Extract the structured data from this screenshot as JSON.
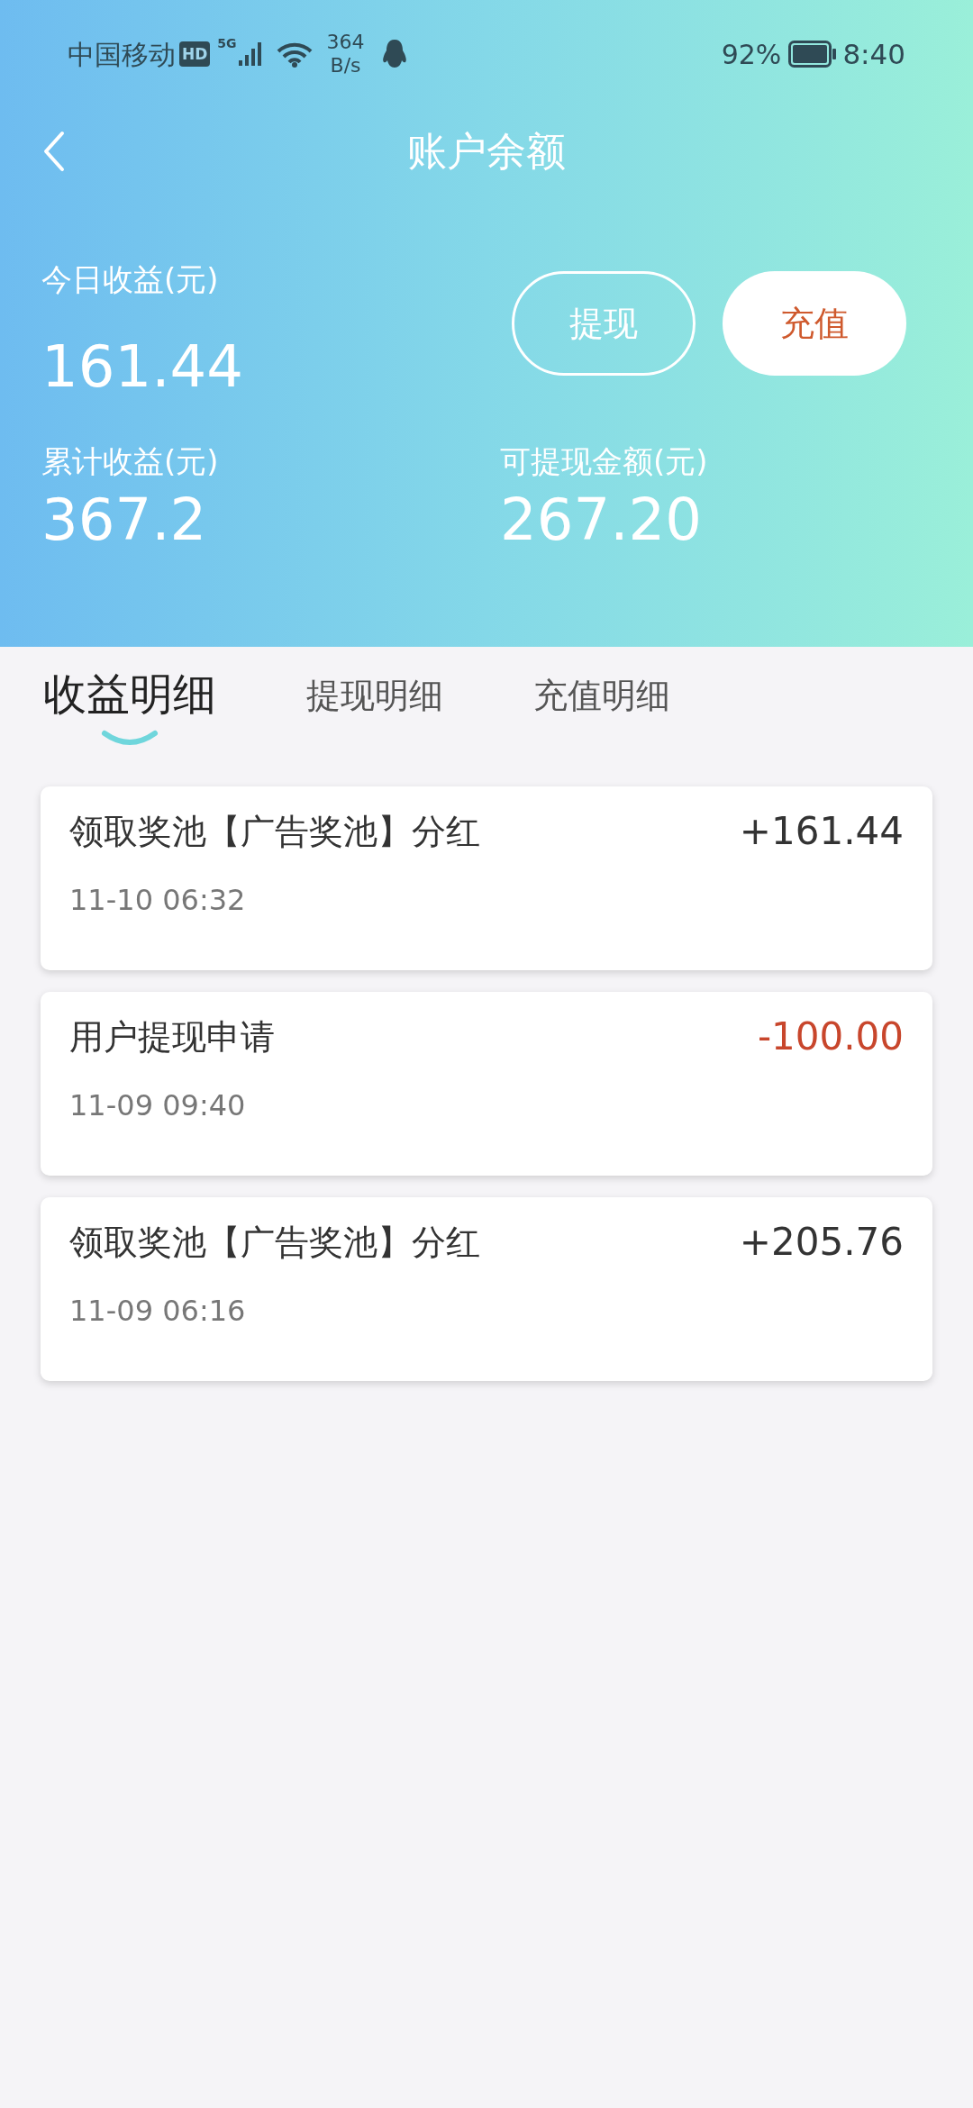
{
  "status_bar": {
    "carrier": "中国移动",
    "hd_badge": "HD",
    "network": "5G",
    "speed_value": "364",
    "speed_unit": "B/s",
    "battery": "92%",
    "time": "8:40"
  },
  "header": {
    "title": "账户余额"
  },
  "summary": {
    "today_label": "今日收益(元)",
    "today_value": "161.44",
    "total_label": "累计收益(元)",
    "total_value": "367.2",
    "withdrawable_label": "可提现金额(元)",
    "withdrawable_value": "267.20",
    "buttons": [
      {
        "label": "提现",
        "kind": "outline"
      },
      {
        "label": "充值",
        "kind": "filled"
      }
    ]
  },
  "tabs": [
    {
      "label": "收益明细",
      "selected": true
    },
    {
      "label": "提现明细",
      "selected": false
    },
    {
      "label": "充值明细",
      "selected": false
    }
  ],
  "records": [
    {
      "title": "领取奖池【广告奖池】分红",
      "time": "11-10 06:32",
      "amount": "+161.44",
      "kind": "income"
    },
    {
      "title": "用户提现申请",
      "time": "11-09 09:40",
      "amount": "-100.00",
      "kind": "expense"
    },
    {
      "title": "领取奖池【广告奖池】分红",
      "time": "11-09 06:16",
      "amount": "+205.76",
      "kind": "income"
    }
  ]
}
